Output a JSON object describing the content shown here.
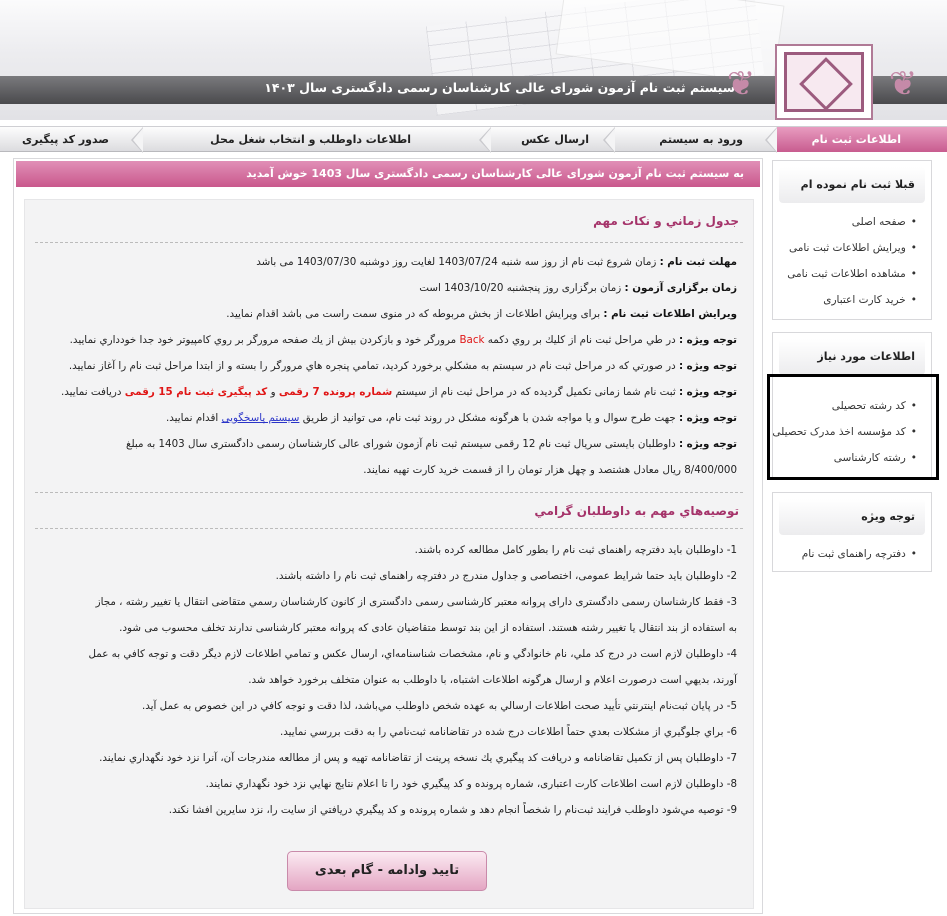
{
  "header": {
    "title": "سیستم ثبت نام آزمون شورای عالی کارشناسان رسمی دادگستری سال ۱۴۰۳"
  },
  "nav": [
    {
      "label": "اطلاعات ثبت نام"
    },
    {
      "label": "ورود به سیستم"
    },
    {
      "label": "ارسال عکس"
    },
    {
      "label": "اطلاعات داوطلب و انتخاب شغل محل"
    },
    {
      "label": "صدور کد پیگیری"
    }
  ],
  "welcome": "به سیستم ثبت نام آزمون شورای عالی کارشناسان رسمی دادگستری سال 1403 خوش آمدید",
  "schedule": {
    "title": "جدول زماني و نكات مهم",
    "deadline_label": "مهلت ثبت نام :",
    "deadline_text": "زمان شروع ثبت نام از روز سه شنبه 1403/07/24 لغایت روز دوشنبه 1403/07/30 می باشد",
    "exam_label": "زمان برگزاری آزمون :",
    "exam_text": "زمان برگزاری روز پنجشنبه 1403/10/20 است",
    "edit_label": "ویرایش اطلاعات ثبت نام :",
    "edit_text": "برای ویرایش اطلاعات از بخش مربوطه که در منوی سمت راست می باشد اقدام نمایید.",
    "note_label": "توجه ویژه :",
    "note1_a": "در طي مراحل ثبت نام از كليك بر روي دكمه",
    "note1_back": "Back",
    "note1_b": "مرورگر خود و بازكردن بيش از يك صفحه مرورگر بر روي كامپيوتر خود جدا خودداري نماييد.",
    "note2": "در صورتي كه در مراحل ثبت نام در سيستم به مشكلي برخورد كرديد، تمامي پنجره هاي مرورگر را بسته و از ابتدا مراحل ثبت نام را آغاز نماييد.",
    "note3_a": "ثبت نام شما زمانی تکمیل گردیده که در مراحل ثبت نام از سیستم",
    "note3_red1": "شماره پرونده 7 رقمی",
    "note3_and": "و",
    "note3_red2": "کد پیگیری ثبت نام 15 رقمی",
    "note3_b": "دریافت نمایید.",
    "note4_a": "جهت طرح سوال و یا مواجه شدن با هرگونه مشکل در روند ثبت نام، می توانید از طریق",
    "note4_link": "سیستم پاسخگویی",
    "note4_b": "اقدام نمایید.",
    "note5_a": "داوطلبان بایستی سریال ثبت نام 12 رقمی سیستم ثبت نام آزمون شورای عالی کارشناسان رسمی دادگستری سال 1403 به مبلغ",
    "note5_b": "8/400/000 ریال معادل هشتصد و چهل هزار تومان را از قسمت خرید کارت تهیه نمایند."
  },
  "recommend": {
    "title": "توصيه‌هاي مهم به داوطلبان گرامي",
    "items": [
      "1- داوطلبان باید دفترچه راهنمای ثبت نام را بطور كامل مطالعه كرده باشند.",
      "2- داوطلبان باید حتما شرایط عمومی، اختصاصی و جداول مندرج در دفترچه راهنمای ثبت نام را داشته باشند.",
      "3- فقط کارشناسان رسمی دادگستری دارای پروانه معتبر کارشناسی رسمی دادگستری از کانون کارشناسان رسمي متقاضی انتقال یا تغییر رشته ، مجاز",
      "به استفاده از بند انتقال یا تغییر رشته هستند. استفاده از این بند توسط متقاضیان عادی که پروانه معتبر کارشناسی ندارند تخلف محسوب می شود.",
      "4- داوطلبان لازم است در درج كد ملي، نام خانوادگي و نام، مشخصات شناسنامه‌اي، ارسال عكس و تمامي اطلاعات لازم ديگر دقت و توجه كافي به عمل",
      "آورند، بديهي است درصورت اعلام و ارسال هرگونه اطلاعات اشتباه، با داوطلب به عنوان متخلف برخورد خواهد شد.",
      "5- در پايان ثبت‌نام اينترنتي تأييد صحت اطلاعات ارسالي به عهده شخص داوطلب مي‌باشد، لذا دقت و توجه كافي در اين خصوص به عمل آيد.",
      "6- براي جلوگيري از مشكلات بعدي حتماً اطلاعات درج شده در تقاضانامه ثبت‌نامي را به دقت بررسي نماييد.",
      "7- داوطلبان پس از تكميل تقاضانامه و دريافت كد پيگيري يك نسخه پرينت از تقاضانامه تهيه و پس از مطالعه مندرجات آن، آنرا نزد خود نگهداري نمايند.",
      "8- داوطلبان لازم است اطلاعات کارت اعتباری، شماره پرونده و كد پيگيري خود را تا اعلام نتايج نهايي نزد خود نگهداري نمايند.",
      "9- توصيه مي‌شود داوطلب فرايند ثبت‌نام را شخصاً انجام دهد و شماره پرونده و كد پيگيري دريافتي از سايت را، نزد سايرين افشا نكند."
    ]
  },
  "button": {
    "label": "تایید وادامه - گام بعدی"
  },
  "sidebar": {
    "registered": {
      "title": "قبلا ثبت نام نموده ام",
      "items": [
        "صفحه اصلی",
        "ویرایش اطلاعات ثبت نامی",
        "مشاهده اطلاعات ثبت نامی",
        "خرید کارت اعتباری"
      ]
    },
    "needed": {
      "title": "اطلاعات مورد نیاز",
      "items": [
        "کد رشته تحصیلی",
        "کد مؤسسه اخذ مدرک تحصیلی",
        "رشته کارشناسی"
      ]
    },
    "special": {
      "title": "توجه ویژه",
      "items": [
        "دفترچه راهنمای ثبت نام"
      ]
    }
  },
  "colors": {
    "accent": "#c9588c",
    "title": "#a5336a",
    "red": "#e01616",
    "link": "#2a34c8"
  }
}
